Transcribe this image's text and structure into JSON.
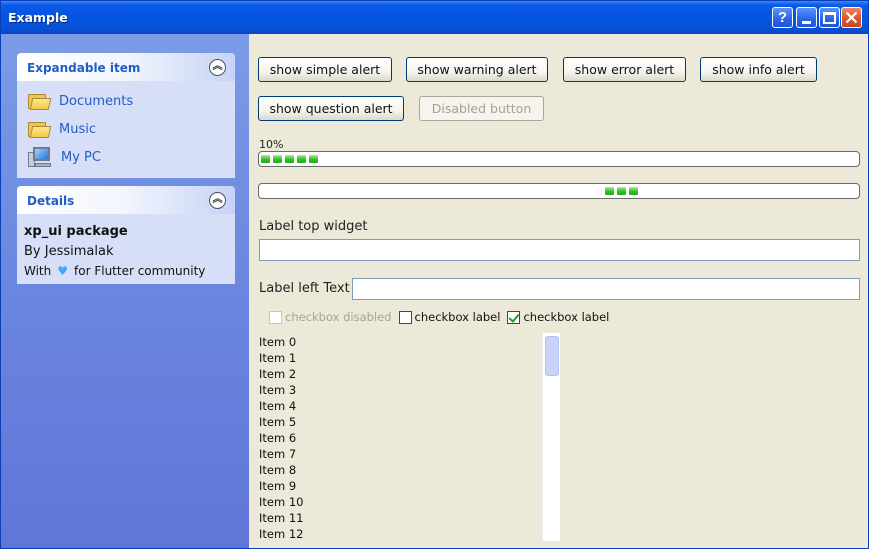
{
  "window": {
    "title": "Example",
    "help_label": "?"
  },
  "sidebar": {
    "panel1": {
      "title": "Expandable item",
      "items": [
        {
          "label": "Documents",
          "icon": "folder-icon"
        },
        {
          "label": "Music",
          "icon": "folder-icon"
        },
        {
          "label": "My PC",
          "icon": "computer-icon"
        }
      ]
    },
    "panel2": {
      "title": "Details",
      "package": "xp_ui package",
      "author": "By Jessimalak",
      "with_prefix": "With",
      "with_suffix": "for Flutter community",
      "heart_icon": "heart-icon"
    }
  },
  "buttons": {
    "simple": "show simple alert",
    "warning": "show warning alert",
    "error": "show error alert",
    "info": "show info alert",
    "question": "show question alert",
    "disabled": "Disabled button"
  },
  "progress": {
    "label": "10%",
    "value": 0.1
  },
  "fields": {
    "top_label": "Label top widget",
    "top_value": "",
    "left_label": "Label left Text",
    "left_value": ""
  },
  "checkboxes": [
    {
      "label": "checkbox disabled",
      "checked": false,
      "disabled": true
    },
    {
      "label": "checkbox label",
      "checked": false,
      "disabled": false
    },
    {
      "label": "checkbox label",
      "checked": true,
      "disabled": false
    }
  ],
  "list": [
    "Item 0",
    "Item 1",
    "Item 2",
    "Item 3",
    "Item 4",
    "Item 5",
    "Item 6",
    "Item 7",
    "Item 8",
    "Item 9",
    "Item 10",
    "Item 11",
    "Item 12"
  ],
  "colors": {
    "title_bar": "#0754e0",
    "link": "#215dc6",
    "progress_green": "#37c229"
  }
}
